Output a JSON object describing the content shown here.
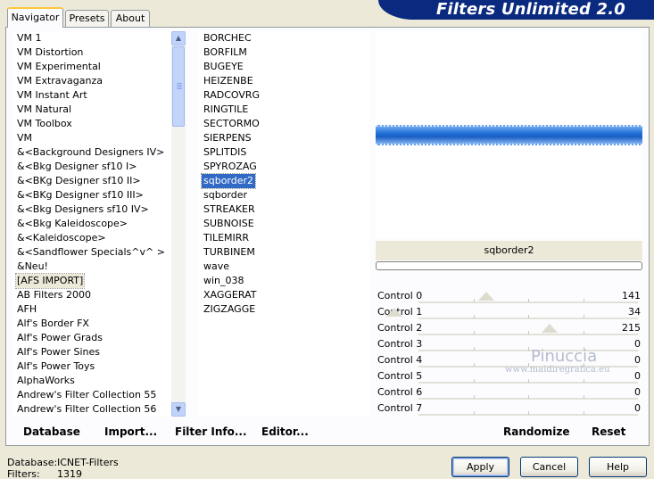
{
  "app": {
    "title": "Filters Unlimited 2.0"
  },
  "tabs": [
    {
      "label": "Navigator"
    },
    {
      "label": "Presets"
    },
    {
      "label": "About"
    }
  ],
  "categories": [
    "VM 1",
    "VM Distortion",
    "VM Experimental",
    "VM Extravaganza",
    "VM Instant Art",
    "VM Natural",
    "VM Toolbox",
    "VM",
    "&<Background Designers IV>",
    "&<Bkg Designer sf10 I>",
    "&<BKg Designer sf10 II>",
    "&<BKg Designer sf10 III>",
    "&<Bkg Designers sf10 IV>",
    "&<Bkg Kaleidoscope>",
    "&<Kaleidoscope>",
    "&<Sandflower Specials^v^ >",
    "&Neu!",
    "[AFS IMPORT]",
    "AB Filters 2000",
    "AFH",
    "Alf's Border FX",
    "Alf's Power Grads",
    "Alf's Power Sines",
    "Alf's Power Toys",
    "AlphaWorks",
    "Andrew's Filter Collection 55",
    "Andrew's Filter Collection 56"
  ],
  "selected_category_index": 17,
  "filters": [
    "BORCHEC",
    "BORFILM",
    "BUGEYE",
    "HEIZENBE",
    "RADCOVRG",
    "RINGTILE",
    "SECTORMO",
    "SIERPENS",
    "SPLITDIS",
    "SPYROZAG",
    "sqborder2",
    "sqborder",
    "STREAKER",
    "SUBNOISE",
    "TILEMIRR",
    "TURBINEM",
    "wave",
    "win_038",
    "XAGGERAT",
    "ZIGZAGGE"
  ],
  "selected_filter_index": 10,
  "preview": {
    "filter_name": "sqborder2",
    "progress": 0
  },
  "controls": [
    {
      "label": "Control 0",
      "value": "141",
      "level": 141
    },
    {
      "label": "Control 1",
      "value": "34",
      "level": 34
    },
    {
      "label": "Control 2",
      "value": "215",
      "level": 215
    },
    {
      "label": "Control 3",
      "value": "0",
      "level": 0
    },
    {
      "label": "Control 4",
      "value": "0",
      "level": 0
    },
    {
      "label": "Control 5",
      "value": "0",
      "level": 0
    },
    {
      "label": "Control 6",
      "value": "0",
      "level": 0
    },
    {
      "label": "Control 7",
      "value": "0",
      "level": 0
    }
  ],
  "control_max": 255,
  "watermark": {
    "name": "Pinuccia",
    "site": "www.maidiregrafica.eu"
  },
  "toolbar": {
    "database_label": "Database",
    "import_label": "Import...",
    "filter_info_label": "Filter Info...",
    "editor_label": "Editor...",
    "randomize_label": "Randomize",
    "reset_label": "Reset"
  },
  "status": {
    "database_label": "Database:",
    "database_value": "ICNET-Filters",
    "filters_label": "Filters:",
    "filters_value": "1319"
  },
  "buttons": {
    "apply": "Apply",
    "cancel": "Cancel",
    "help": "Help"
  },
  "colors": {
    "banner": "#0a2a80",
    "selection": "#316ac5",
    "preview_band": "#1e6fd6"
  }
}
